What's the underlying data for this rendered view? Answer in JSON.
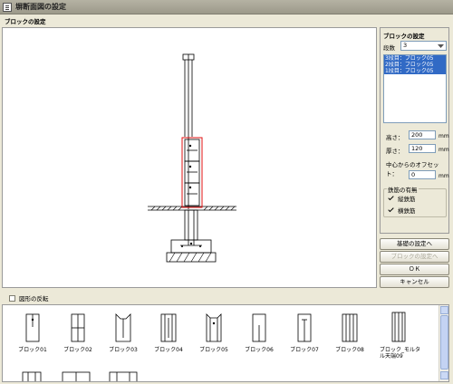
{
  "window": {
    "title": "塀断面図の設定"
  },
  "section": {
    "title": "ブロックの設定"
  },
  "side": {
    "panel_title": "ブロックの設定",
    "tiers_label": "段数",
    "tiers_value": "3",
    "list_items": [
      "3段目：ブロック05",
      "2段目：ブロック05",
      "1段目：ブロック05"
    ],
    "height_label": "高さ：",
    "height_value": "200",
    "thickness_label": "厚さ：",
    "thickness_value": "120",
    "offset_label": "中心からのオフセット：",
    "offset_value": "0",
    "unit": "mm",
    "rebar_group_label": "鉄筋の有無",
    "vertical_rebar_label": "縦鉄筋",
    "horizontal_rebar_label": "横鉄筋"
  },
  "buttons": {
    "foundation": "基礎の設定へ",
    "block": "ブロックの設定へ",
    "ok": "ＯＫ",
    "cancel": "キャンセル"
  },
  "flip_label": "図形の反転",
  "thumbnails": [
    "ブロック01",
    "ブロック02",
    "ブロック03",
    "ブロック04",
    "ブロック05",
    "ブロック06",
    "ブロック07",
    "ブロック08",
    "ブロック_モルタル天端09"
  ],
  "colors": {
    "selection": "#316ac5",
    "highlight": "#e01010",
    "window_bg": "#ece9d8"
  }
}
